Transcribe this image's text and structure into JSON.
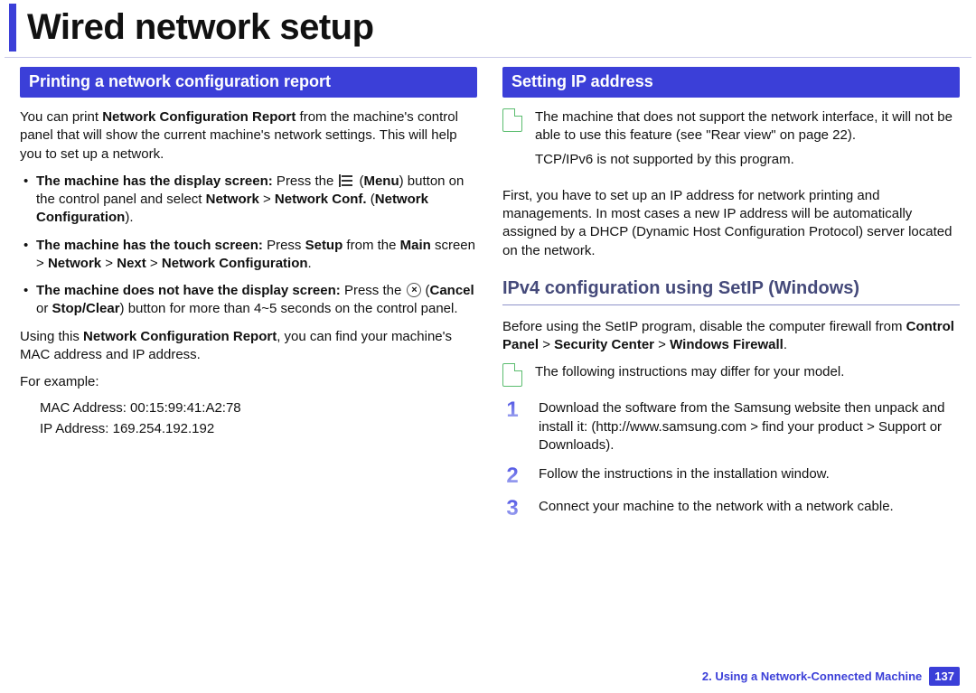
{
  "page": {
    "title": "Wired network setup",
    "footer_chapter": "2.  Using a Network-Connected Machine",
    "page_number": "137"
  },
  "left": {
    "section_title": "Printing a network configuration report",
    "intro_a": "You can print ",
    "intro_b": "Network Configuration Report",
    "intro_c": " from the machine's control panel that will show the current machine's network settings. This will help you to set up a network.",
    "li1_lead": "The machine has the display screen:",
    "li1_a": " Press the ",
    "li1_b": "Menu",
    "li1_c": ") button on the control panel and select ",
    "li1_d": "Network",
    "li1_e": " > ",
    "li1_f": "Network Conf.",
    "li1_g": " (",
    "li1_h": "Network Configuration",
    "li1_i": ").",
    "li2_lead": "The machine has the touch screen:",
    "li2_a": " Press ",
    "li2_b": "Setup",
    "li2_c": " from the ",
    "li2_d": "Main",
    "li2_e": " screen > ",
    "li2_f": "Network",
    "li2_g": " > ",
    "li2_h": "Next",
    "li2_i": " > ",
    "li2_j": "Network Configuration",
    "li2_k": ".",
    "li3_lead": "The machine does not have the display screen:",
    "li3_a": " Press the ",
    "li3_b": "Cancel",
    "li3_c": " or ",
    "li3_d": "Stop/Clear",
    "li3_e": ") button for more than 4~5 seconds on the control panel.",
    "use_a": "Using this ",
    "use_b": "Network Configuration Report",
    "use_c": ", you can find your machine's MAC address and IP address.",
    "example_label": "For example:",
    "mac": "MAC Address: 00:15:99:41:A2:78",
    "ip": "IP Address: 169.254.192.192"
  },
  "right": {
    "section_title": "Setting IP address",
    "note1_li1": "The machine that does not support the network interface, it will not be able to use this feature (see \"Rear view\" on page 22).",
    "note1_li2": "TCP/IPv6 is not supported by this program.",
    "para1": "First, you have to set up an IP address for network printing and managements. In most cases a new IP address will be automatically assigned by a DHCP (Dynamic Host Configuration Protocol) server located on the network.",
    "subheading": "IPv4 configuration using SetIP (Windows)",
    "para2_a": "Before using the SetIP program, disable the computer firewall from ",
    "para2_b": "Control Panel",
    "para2_c": " > ",
    "para2_d": "Security Center",
    "para2_e": " > ",
    "para2_f": "Windows Firewall",
    "para2_g": ".",
    "note2": "The following instructions may differ for your model.",
    "steps": {
      "s1": "Download the software from the Samsung website then unpack and install it: (http://www.samsung.com > find your product > Support or Downloads).",
      "s2": "Follow the instructions in the installation window.",
      "s3": "Connect your machine to the network with a network cable."
    },
    "nums": {
      "n1": "1",
      "n2": "2",
      "n3": "3"
    }
  }
}
